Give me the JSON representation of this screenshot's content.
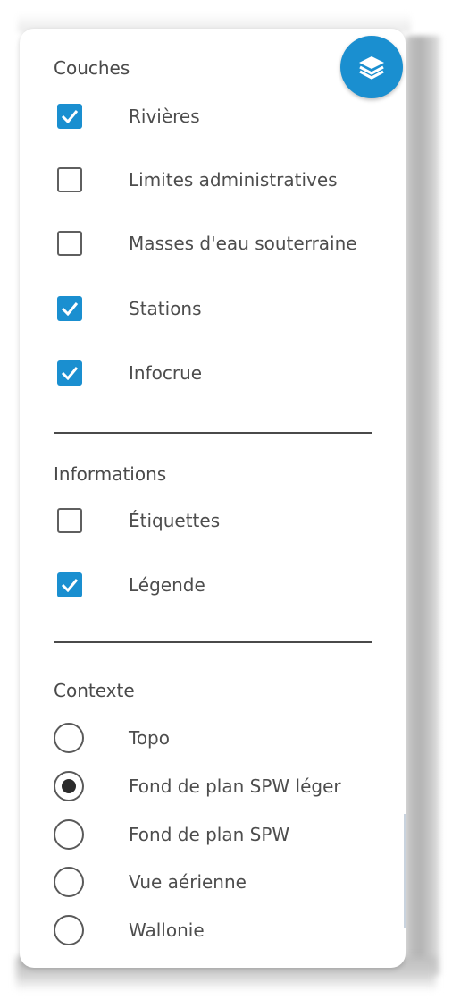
{
  "layers_button": {
    "icon": "layers-icon",
    "color": "#1a8fd0"
  },
  "couches": {
    "title": "Couches",
    "items": [
      {
        "label": "Rivières",
        "checked": true
      },
      {
        "label": "Limites administratives",
        "checked": false
      },
      {
        "label": "Masses d'eau souterraine",
        "checked": false
      },
      {
        "label": "Stations",
        "checked": true
      },
      {
        "label": "Infocrue",
        "checked": true
      }
    ]
  },
  "informations": {
    "title": "Informations",
    "items": [
      {
        "label": "Étiquettes",
        "checked": false
      },
      {
        "label": "Légende",
        "checked": true
      }
    ]
  },
  "contexte": {
    "title": "Contexte",
    "options": [
      {
        "label": "Topo",
        "selected": false
      },
      {
        "label": "Fond de plan SPW léger",
        "selected": true
      },
      {
        "label": "Fond de plan SPW",
        "selected": false
      },
      {
        "label": "Vue aérienne",
        "selected": false
      },
      {
        "label": "Wallonie",
        "selected": false
      }
    ]
  },
  "accent_color": "#1a8fd0"
}
